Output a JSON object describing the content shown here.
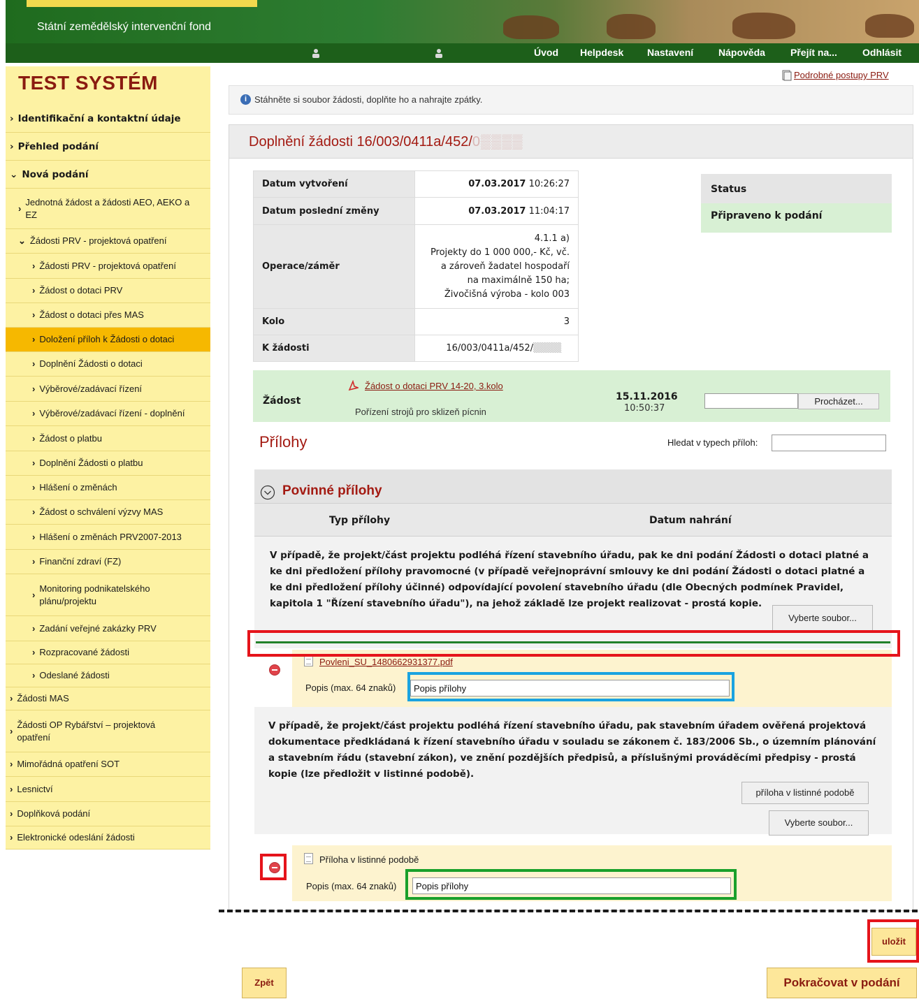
{
  "header": {
    "org_name": "Státní zemědělský intervenční fond",
    "nav": [
      "Úvod",
      "Helpdesk",
      "Nastavení",
      "Nápověda",
      "Přejít na...",
      "Odhlásit"
    ]
  },
  "sidebar": {
    "title": "TEST SYSTÉM",
    "items": [
      {
        "label": "Identifikační a kontaktní údaje"
      },
      {
        "label": "Přehled podání"
      },
      {
        "label": "Nová podání"
      },
      {
        "label": "Jednotná žádost a žádosti AEO, AEKO a EZ"
      },
      {
        "label": "Žádosti PRV - projektová opatření"
      },
      {
        "label": "Žádosti PRV - projektová opatření"
      },
      {
        "label": "Žádost o dotaci PRV"
      },
      {
        "label": "Žádost o dotaci přes MAS"
      },
      {
        "label": "Doložení příloh k Žádosti o dotaci"
      },
      {
        "label": "Doplnění Žádosti o dotaci"
      },
      {
        "label": "Výběrové/zadávací řízení"
      },
      {
        "label": "Výběrové/zadávací řízení - doplnění"
      },
      {
        "label": "Žádost o platbu"
      },
      {
        "label": "Doplnění Žádosti o platbu"
      },
      {
        "label": "Hlášení o změnách"
      },
      {
        "label": "Žádost o schválení výzvy MAS"
      },
      {
        "label": "Hlášení o změnách PRV2007-2013"
      },
      {
        "label": "Finanční zdraví (FZ)"
      },
      {
        "label": "Monitoring podnikatelského plánu/projektu"
      },
      {
        "label": "Zadání veřejné zakázky PRV"
      },
      {
        "label": "Rozpracované žádosti"
      },
      {
        "label": "Odeslané žádosti"
      },
      {
        "label": "Žádosti MAS"
      },
      {
        "label": "Žádosti OP Rybářství – projektová opatření"
      },
      {
        "label": "Mimořádná opatření SOT"
      },
      {
        "label": "Lesnictví"
      },
      {
        "label": "Doplňková podání"
      },
      {
        "label": "Elektronické odeslání žádosti"
      }
    ]
  },
  "main": {
    "procedures_link": "Podrobné postupy PRV",
    "info_message": "Stáhněte si soubor žádosti, doplňte ho a nahrajte zpátky.",
    "panel_title": "Doplnění žádosti 16/003/0411a/452/",
    "details": [
      {
        "key": "Datum vytvoření",
        "date": "07.03.2017",
        "time": "10:26:27"
      },
      {
        "key": "Datum poslední změny",
        "date": "07.03.2017",
        "time": "11:04:17"
      },
      {
        "key": "Operace/záměr",
        "lines": [
          "4.1.1 a)",
          "Projekty do 1 000 000,- Kč, vč.",
          "a zároveň žadatel hospodaří",
          "na maximálně 150 ha;",
          "Živočišná výroba - kolo 003"
        ]
      },
      {
        "key": "Kolo",
        "value": "3"
      },
      {
        "key": "K žádosti",
        "value": "16/003/0411a/452/"
      }
    ],
    "status": {
      "label": "Status",
      "value": "Připraveno k podání"
    },
    "zadost": {
      "label": "Žádost",
      "file_link": "Žádost o dotaci PRV 14-20, 3.kolo",
      "subject": "Pořízení strojů pro sklizeň pícnin",
      "date": "15.11.2016",
      "time": "10:50:37",
      "browse_button": "Procházet..."
    },
    "prilohy_title": "Přílohy",
    "search_label": "Hledat v typech příloh:",
    "search_value": "",
    "section_title": "Povinné přílohy",
    "col_type": "Typ přílohy",
    "col_date": "Datum nahrání",
    "attachment1": {
      "text": "V případě, že projekt/část projektu podléhá řízení stavebního úřadu, pak ke dni podání Žádosti o dotaci platné a ke dni předložení přílohy pravomocné (v případě veřejnoprávní smlouvy ke dni podání Žádosti o dotaci platné a ke dni předložení přílohy účinné) odpovídající povolení stavebního úřadu (dle Obecných podmínek Pravidel, kapitola 1 \"Řízení stavebního úřadu\"), na jehož základě lze projekt realizovat - prostá kopie.",
      "select_button": "Vyberte soubor...",
      "file_name": "Povleni_SU_1480662931377.pdf",
      "desc_label": "Popis (max. 64 znaků)",
      "desc_value": "Popis přílohy"
    },
    "attachment2": {
      "text": "V případě, že projekt/část projektu podléhá řízení stavebního úřadu, pak stavebním úřadem ověřená projektová dokumentace předkládaná k řízení stavebního úřadu v souladu se zákonem č. 183/2006 Sb., o územním plánování a stavebním řádu (stavební zákon), ve znění pozdějších předpisů, a příslušnými prováděcími předpisy - prostá kopie (lze předložit v listinné podobě).",
      "paper_button": "příloha v listinné podobě",
      "select_button": "Vyberte soubor...",
      "file_name": "Příloha v listinné podobě",
      "desc_label": "Popis (max. 64 znaků)",
      "desc_value": "Popis přílohy"
    },
    "save_button": "uložit",
    "back_button": "Zpět",
    "continue_button": "Pokračovat v podání"
  },
  "colors": {
    "header_green": "#1d5f1a",
    "sidebar_yellow": "#fdf2a3",
    "sidebar_active": "#f6b800",
    "title_red": "#a31a12",
    "annotation_red": "#e5141b",
    "annotation_blue": "#1aa3e0",
    "annotation_green": "#19a02b"
  }
}
